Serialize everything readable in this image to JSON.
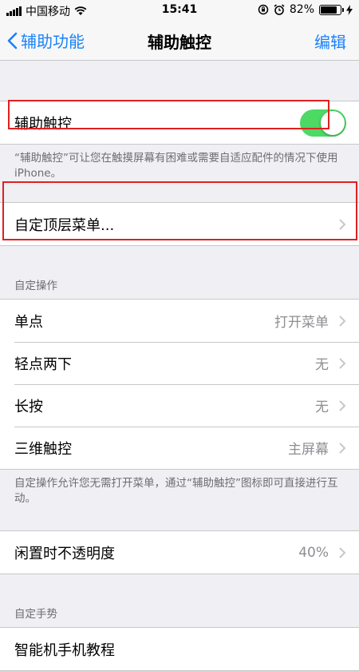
{
  "status_bar": {
    "carrier": "中国移动",
    "time": "15:41",
    "battery": "82%"
  },
  "nav": {
    "back_label": "辅助功能",
    "title": "辅助触控",
    "edit_label": "编辑"
  },
  "assistive_touch": {
    "label": "辅助触控",
    "enabled": true,
    "description": "“辅助触控”可让您在触摸屏幕有困难或需要自适应配件的情况下使用 iPhone。"
  },
  "customize_menu": {
    "label": "自定顶层菜单..."
  },
  "custom_actions": {
    "header": "自定操作",
    "items": [
      {
        "label": "单点",
        "value": "打开菜单"
      },
      {
        "label": "轻点两下",
        "value": "无"
      },
      {
        "label": "长按",
        "value": "无"
      },
      {
        "label": "三维触控",
        "value": "主屏幕"
      }
    ],
    "footer": "自定操作允许您无需打开菜单，通过“辅助触控”图标即可直接进行互动。"
  },
  "idle_opacity": {
    "label": "闲置时不透明度",
    "value": "40%"
  },
  "custom_gestures": {
    "header": "自定手势",
    "first_item": "智能机手机教程"
  },
  "colors": {
    "accent": "#1a82fb",
    "toggle_on": "#4cd964",
    "highlight": "#e02020"
  }
}
